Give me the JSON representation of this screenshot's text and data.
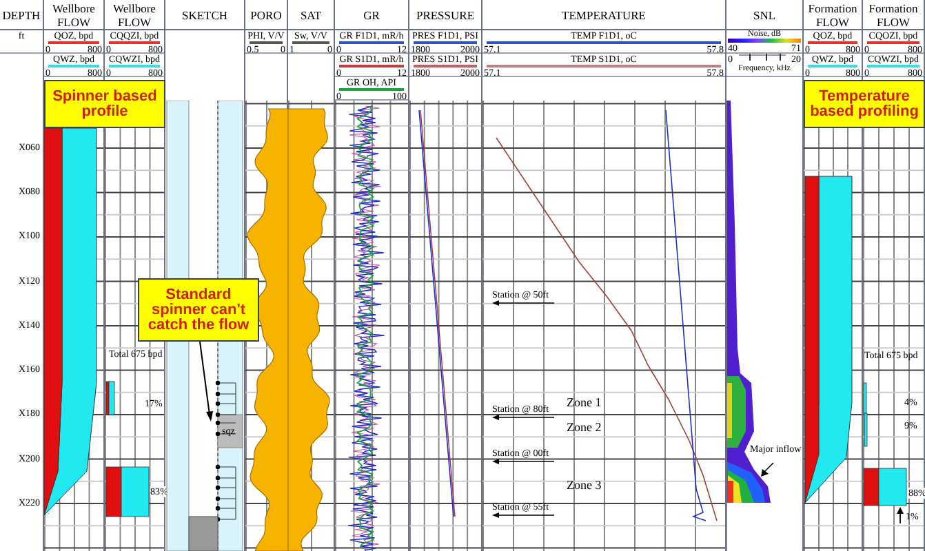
{
  "tracks": [
    {
      "title": "DEPTH",
      "scales": [
        {
          "kind": "unit",
          "label": "ft"
        }
      ]
    },
    {
      "title": "Wellbore FLOW",
      "scales": [
        {
          "kind": "curve",
          "label": "QOZ, bpd",
          "min": "0",
          "max": "800",
          "color": "#e03030"
        },
        {
          "kind": "curve",
          "label": "QWZ, bpd",
          "min": "0",
          "max": "800",
          "color": "#40d8e8"
        }
      ]
    },
    {
      "title": "Wellbore FLOW",
      "scales": [
        {
          "kind": "curve",
          "label": "CQQZI, bpd",
          "min": "0",
          "max": "800",
          "color": "#e03030"
        },
        {
          "kind": "curve",
          "label": "CQWZI, bpd",
          "min": "0",
          "max": "800",
          "color": "#40d8e8"
        }
      ]
    },
    {
      "title": "SKETCH"
    },
    {
      "title": "PORO",
      "scales": [
        {
          "kind": "curve",
          "label": "PHI, V/V",
          "min": "0.5",
          "max": "0",
          "color": "#555555"
        }
      ]
    },
    {
      "title": "SAT",
      "scales": [
        {
          "kind": "curve",
          "label": "Sw, V/V",
          "min": "1",
          "max": "0",
          "color": "#555555"
        }
      ]
    },
    {
      "title": "GR",
      "scales": [
        {
          "kind": "curve",
          "label": "GR F1D1, mR/h",
          "min": "0",
          "max": "12",
          "color": "#3050c0"
        },
        {
          "kind": "curve",
          "label": "GR S1D1, mR/h",
          "min": "0",
          "max": "12",
          "color": "#c04040"
        },
        {
          "kind": "curve",
          "label": "GR OH, API",
          "min": "0",
          "max": "100",
          "color": "#20a040"
        }
      ]
    },
    {
      "title": "PRESSURE",
      "scales": [
        {
          "kind": "curve",
          "label": "PRES F1D1, PSI",
          "min": "1800",
          "max": "2000",
          "color": "#3050c0"
        },
        {
          "kind": "curve",
          "label": "PRES S1D1, PSI",
          "min": "1800",
          "max": "2000",
          "color": "#c06060"
        }
      ]
    },
    {
      "title": "TEMPERATURE",
      "scales": [
        {
          "kind": "curve",
          "label": "TEMP F1D1, oC",
          "min": "57.1",
          "max": "57.8",
          "color": "#3050c0"
        },
        {
          "kind": "curve",
          "label": "TEMP S1D1, oC",
          "min": "57.1",
          "max": "57.8",
          "color": "#c08080"
        }
      ]
    },
    {
      "title": "SNL",
      "scales": [
        {
          "kind": "colorbar",
          "label": "Noise, dB",
          "min": "40",
          "max": "71"
        },
        {
          "kind": "axis",
          "label": "Frequency, kHz",
          "min": "0",
          "max": "20"
        }
      ]
    },
    {
      "title": "Formation FLOW",
      "scales": [
        {
          "kind": "curve",
          "label": "QOZ, bpd",
          "min": "0",
          "max": "800",
          "color": "#e03030"
        },
        {
          "kind": "curve",
          "label": "QWZ, bpd",
          "min": "0",
          "max": "800",
          "color": "#40d8e8"
        }
      ]
    },
    {
      "title": "Formation FLOW",
      "scales": [
        {
          "kind": "curve",
          "label": "CQOZI, bpd",
          "min": "0",
          "max": "800",
          "color": "#e03030"
        },
        {
          "kind": "curve",
          "label": "CQWZI, bpd",
          "min": "0",
          "max": "800",
          "color": "#40d8e8"
        }
      ]
    }
  ],
  "depth_labels": [
    "X060",
    "X080",
    "X100",
    "X120",
    "X140",
    "X160",
    "X180",
    "X200",
    "X220"
  ],
  "callouts": [
    "Spinner based profile",
    "Standard spinner can't catch the flow",
    "Temperature based profiling"
  ],
  "wellbore_flow": {
    "total": "Total 675 bpd",
    "shares": [
      "17%",
      "83%"
    ]
  },
  "sketch": {
    "plug_label": "sqz"
  },
  "stations": [
    "Station @  50ft",
    "Station @  80ft",
    "Station @  00ft",
    "Station @  55ft"
  ],
  "zones": [
    "Zone 1",
    "Zone 2",
    "Zone 3"
  ],
  "snl": {
    "note": "Major inflow"
  },
  "formation_flow": {
    "total": "Total 675 bpd",
    "shares": [
      "4%",
      "9%",
      "88%",
      "1%"
    ]
  }
}
